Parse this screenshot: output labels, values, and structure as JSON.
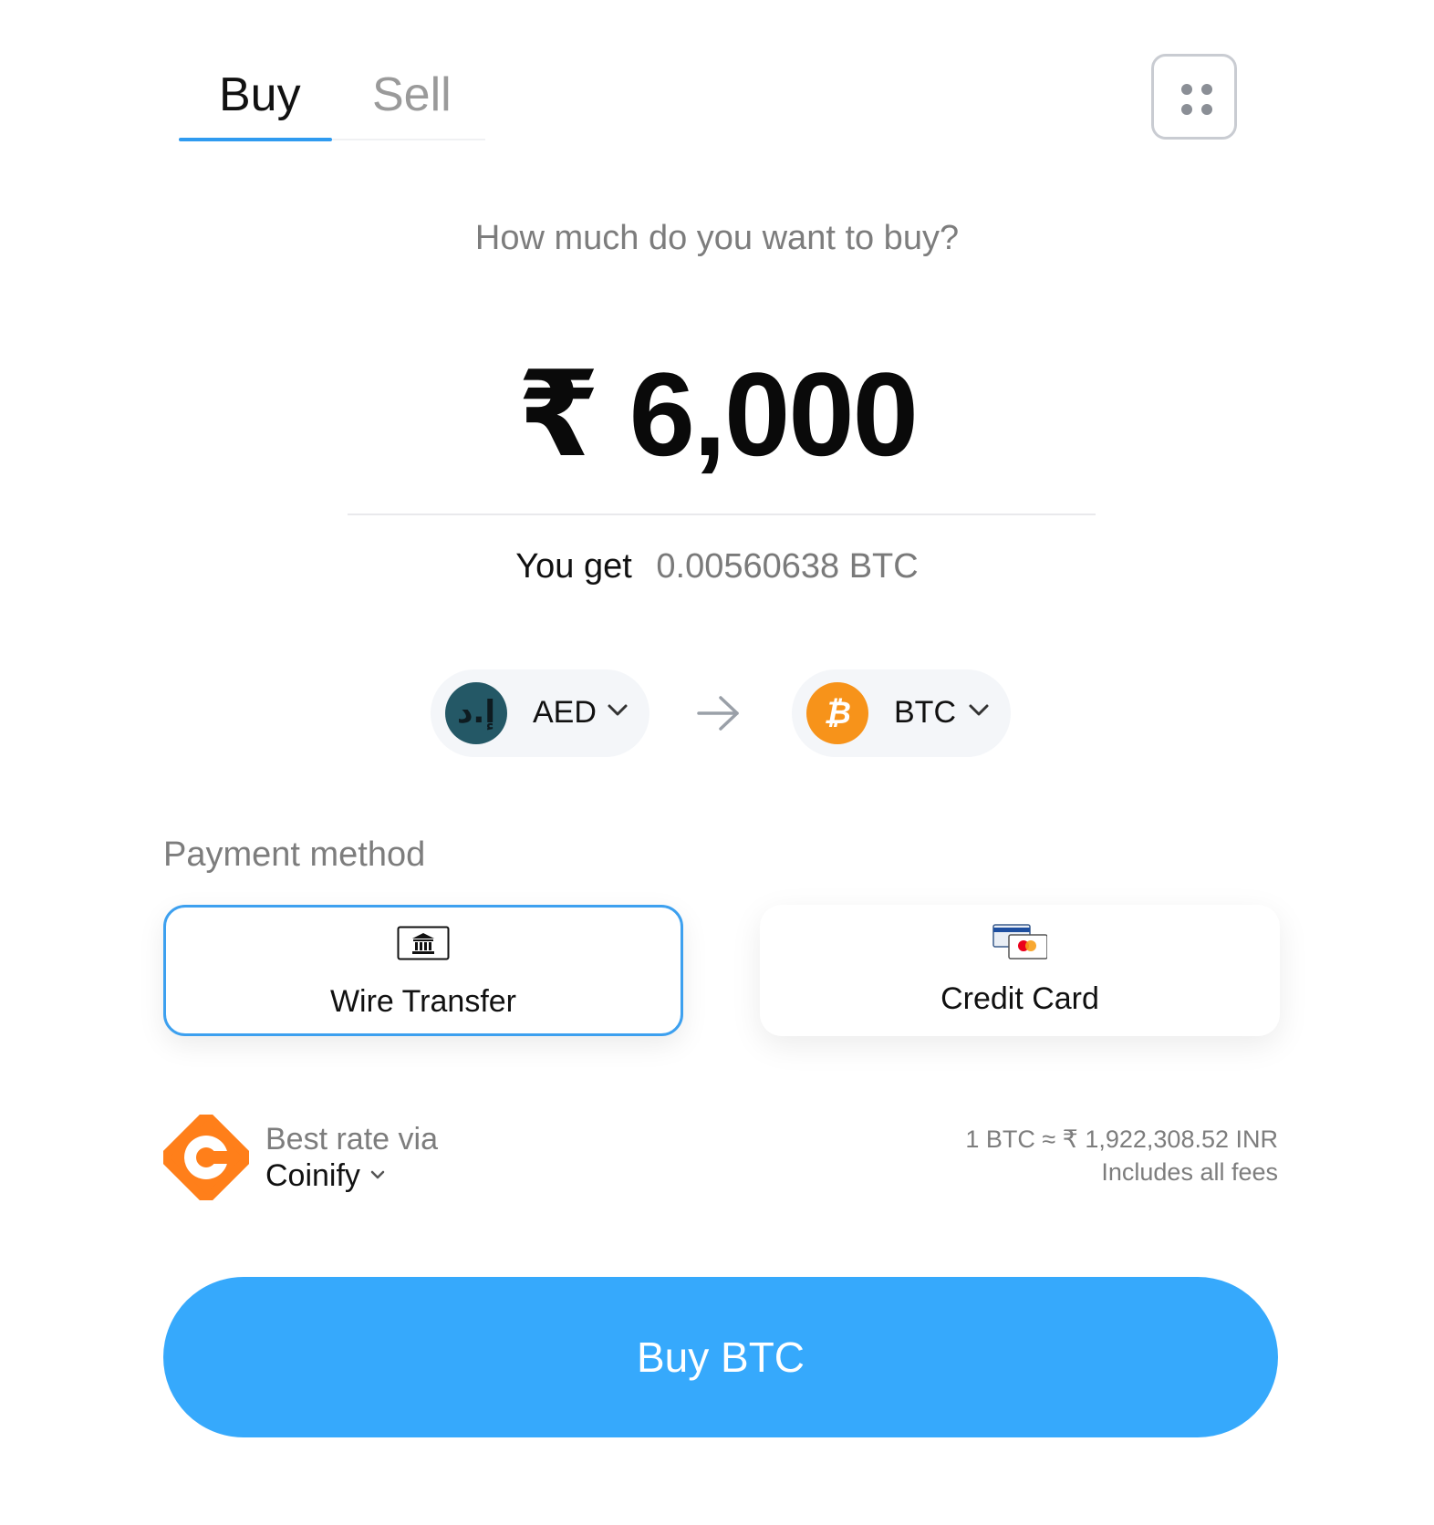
{
  "tabs": [
    {
      "label": "Buy",
      "active": true
    },
    {
      "label": "Sell",
      "active": false
    }
  ],
  "prompt": "How much do you want to buy?",
  "amount": "₹ 6,000",
  "receive": {
    "label": "You get",
    "value": "0.00560638 BTC"
  },
  "from_currency": {
    "code": "AED",
    "symbol": "إ.د",
    "icon": "aed-coin-icon"
  },
  "to_currency": {
    "code": "BTC",
    "symbol": "₿",
    "icon": "bitcoin-icon"
  },
  "payment": {
    "title": "Payment method",
    "methods": [
      {
        "label": "Wire Transfer",
        "icon": "bank-icon",
        "selected": true
      },
      {
        "label": "Credit Card",
        "icon": "cards-icon",
        "selected": false
      }
    ]
  },
  "provider": {
    "line1": "Best rate via",
    "name": "Coinify",
    "icon": "coinify-logo"
  },
  "rate": {
    "line1": "1 BTC ≈ ₹ 1,922,308.52 INR",
    "line2": "Includes all fees"
  },
  "cta": {
    "label": "Buy BTC"
  },
  "colors": {
    "accent": "#36a9fc",
    "btc": "#f7931a",
    "aed": "#245866",
    "coinify": "#ff7f1a"
  }
}
